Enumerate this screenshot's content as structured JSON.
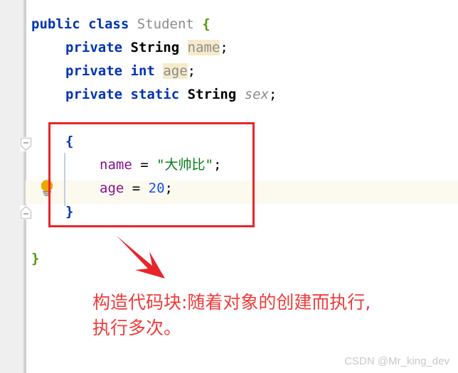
{
  "editor": {
    "language": "Java",
    "gutter": {
      "fold_open_icon": "fold-collapse-icon",
      "fold_close_icon": "fold-collapse-end-icon",
      "intention_icon": "lightbulb-icon"
    },
    "colors": {
      "keyword": "#0033b3",
      "class_name": "#8c8c8c",
      "type_name": "#000000",
      "brace_green": "#4d9a06",
      "field_reference": "#871094",
      "string_literal": "#067d17",
      "number_literal": "#1750eb",
      "unused_field": "#8c8c8c",
      "identifier_highlight_bg": "#f5ebcb",
      "current_line_bg": "#fcfaef",
      "gutter_bg": "#efefef",
      "annotation_red": "#ef3b3b",
      "shape_red": "#e8252a",
      "indent_guide": "#c5cedb"
    },
    "lines": [
      {
        "n": 1,
        "indent": 0,
        "tokens": [
          {
            "t": "public",
            "c": "kw"
          },
          {
            "t": " ",
            "c": "punct"
          },
          {
            "t": "class",
            "c": "kw"
          },
          {
            "t": " ",
            "c": "punct"
          },
          {
            "t": "Student",
            "c": "cls"
          },
          {
            "t": " ",
            "c": "punct"
          },
          {
            "t": "{",
            "c": "brace-g"
          }
        ]
      },
      {
        "n": 2,
        "indent": 1,
        "tokens": [
          {
            "t": "private",
            "c": "kw"
          },
          {
            "t": " ",
            "c": "punct"
          },
          {
            "t": "String",
            "c": "typ"
          },
          {
            "t": " ",
            "c": "punct"
          },
          {
            "t": "name",
            "c": "fld-unused"
          },
          {
            "t": ";",
            "c": "punct"
          }
        ]
      },
      {
        "n": 3,
        "indent": 1,
        "tokens": [
          {
            "t": "private",
            "c": "kw"
          },
          {
            "t": " ",
            "c": "punct"
          },
          {
            "t": "int",
            "c": "kw"
          },
          {
            "t": " ",
            "c": "punct"
          },
          {
            "t": "age",
            "c": "fld-unused"
          },
          {
            "t": ";",
            "c": "punct"
          }
        ]
      },
      {
        "n": 4,
        "indent": 1,
        "tokens": [
          {
            "t": "private",
            "c": "kw"
          },
          {
            "t": " ",
            "c": "punct"
          },
          {
            "t": "static",
            "c": "kw"
          },
          {
            "t": " ",
            "c": "punct"
          },
          {
            "t": "String",
            "c": "typ"
          },
          {
            "t": " ",
            "c": "punct"
          },
          {
            "t": "sex",
            "c": "fld-static"
          },
          {
            "t": ";",
            "c": "punct"
          }
        ]
      },
      {
        "n": 5,
        "indent": 0,
        "tokens": []
      },
      {
        "n": 6,
        "indent": 1,
        "tokens": [
          {
            "t": "{",
            "c": "brace-b"
          }
        ]
      },
      {
        "n": 7,
        "indent": 2,
        "tokens": [
          {
            "t": "name",
            "c": "fld-ref"
          },
          {
            "t": " = ",
            "c": "op"
          },
          {
            "t": "\"大帅比\"",
            "c": "str"
          },
          {
            "t": ";",
            "c": "punct"
          }
        ]
      },
      {
        "n": 8,
        "indent": 2,
        "tokens": [
          {
            "t": "age",
            "c": "fld-ref"
          },
          {
            "t": " = ",
            "c": "op"
          },
          {
            "t": "20",
            "c": "num"
          },
          {
            "t": ";",
            "c": "punct"
          }
        ]
      },
      {
        "n": 9,
        "indent": 1,
        "tokens": [
          {
            "t": "}",
            "c": "brace-b"
          }
        ]
      },
      {
        "n": 10,
        "indent": 0,
        "tokens": []
      },
      {
        "n": 11,
        "indent": 0,
        "tokens": [
          {
            "t": "}",
            "c": "brace-g"
          }
        ]
      }
    ]
  },
  "annotation": {
    "text": "构造代码块:随着对象的创建而执行,\n执行多次。",
    "line1": "构造代码块:随着对象的创建而执行,",
    "line2": "执行多次。",
    "arrow_icon": "arrow-down-right-icon",
    "highlight_box_label": "instance-initializer-block"
  },
  "watermark": {
    "text": "CSDN @Mr_king_dev"
  }
}
